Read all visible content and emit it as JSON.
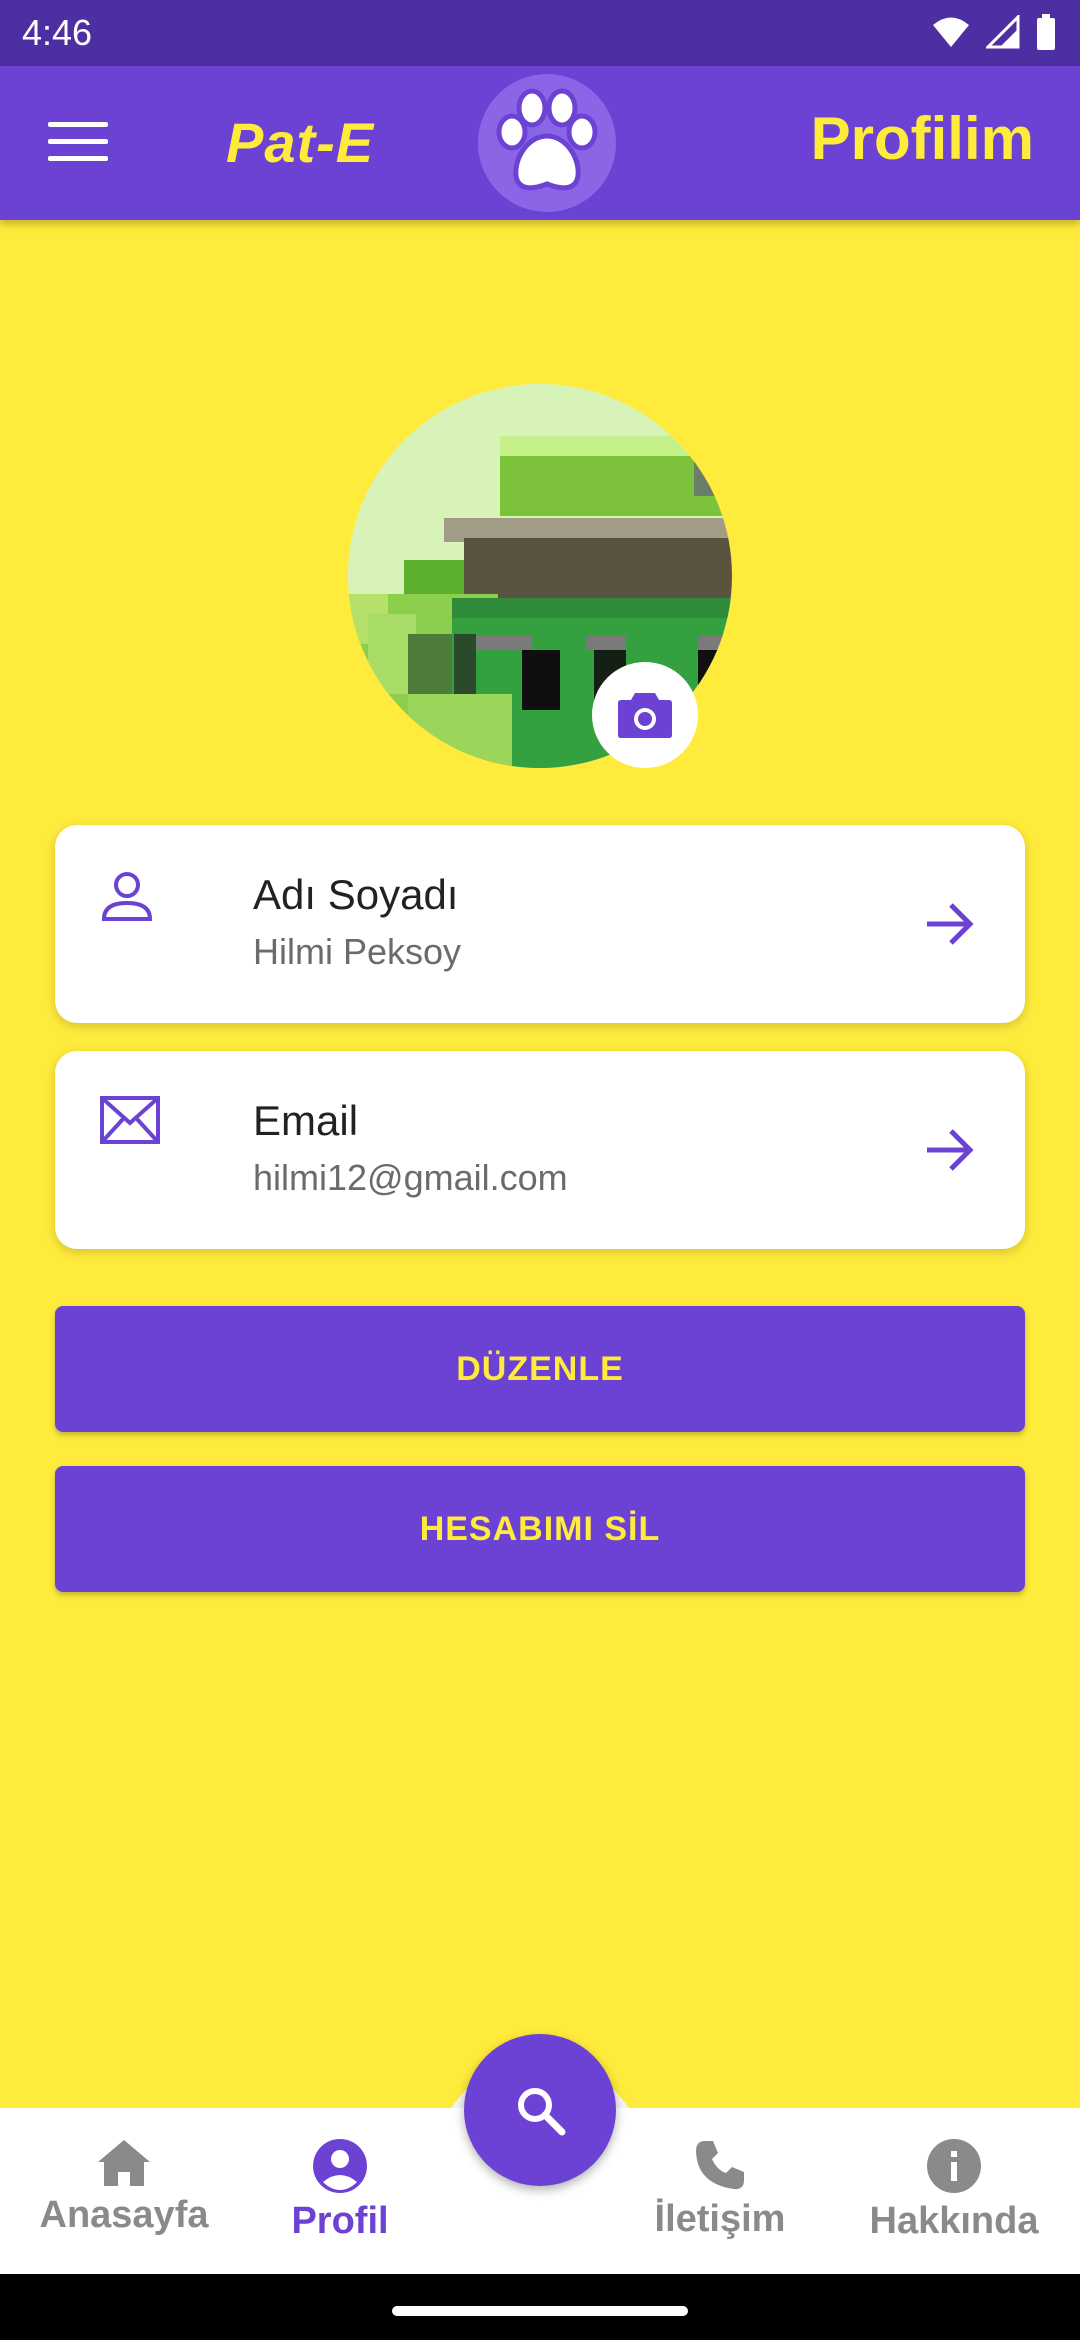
{
  "status_bar": {
    "time": "4:46"
  },
  "app_bar": {
    "brand": "Pat-E",
    "title": "Profilim"
  },
  "profile": {
    "name_card": {
      "title": "Adı Soyadı",
      "value": "Hilmi Peksoy"
    },
    "email_card": {
      "title": "Email",
      "value": "hilmi12@gmail.com"
    }
  },
  "actions": {
    "edit_label": "DÜZENLE",
    "delete_label": "HESABIMI SİL"
  },
  "bottom_nav": {
    "items": [
      {
        "label": "Anasayfa",
        "icon": "home-icon"
      },
      {
        "label": "Profil",
        "icon": "account-icon"
      },
      {
        "label": "İletişim",
        "icon": "phone-icon"
      },
      {
        "label": "Hakkında",
        "icon": "info-icon"
      }
    ],
    "active": "Profil"
  },
  "colors": {
    "primary": "#6b42d3",
    "accent": "#ffeb3b",
    "status_bar": "#4e2fa3"
  }
}
